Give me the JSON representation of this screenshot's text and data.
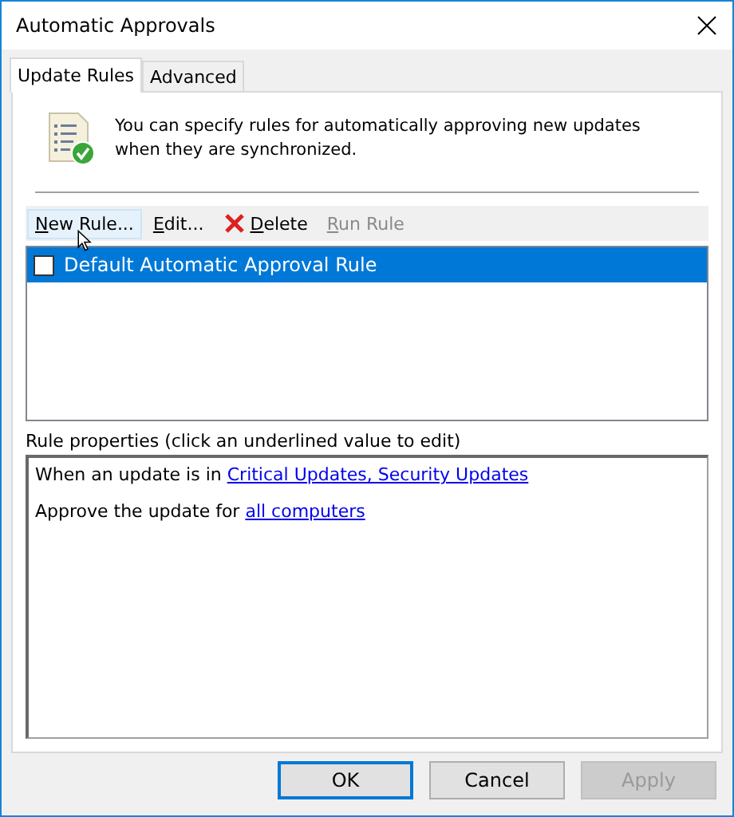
{
  "window": {
    "title": "Automatic Approvals"
  },
  "tabs": [
    {
      "label": "Update Rules",
      "selected": true
    },
    {
      "label": "Advanced",
      "selected": false
    }
  ],
  "intro": "You can specify rules for automatically approving new updates when they are synchronized.",
  "toolbar": [
    {
      "label": "New Rule...",
      "kind": "text",
      "hovered": true,
      "disabled": false
    },
    {
      "label": "Edit...",
      "kind": "text",
      "hovered": false,
      "disabled": false
    },
    {
      "label": "Delete",
      "kind": "delete",
      "hovered": false,
      "disabled": false
    },
    {
      "label": "Run Rule",
      "kind": "text",
      "hovered": false,
      "disabled": true
    }
  ],
  "rules": [
    {
      "name": "Default Automatic Approval Rule",
      "checked": false,
      "selected": true
    }
  ],
  "properties": {
    "label": "Rule properties (click an underlined value to edit)",
    "lines": [
      {
        "text": "When an update is in",
        "link": "Critical Updates, Security Updates"
      },
      {
        "text": "Approve the update for",
        "link": "all computers"
      }
    ]
  },
  "buttons": [
    {
      "label": "OK",
      "default": true,
      "disabled": false
    },
    {
      "label": "Cancel",
      "default": false,
      "disabled": false
    },
    {
      "label": "Apply",
      "default": false,
      "disabled": true
    }
  ]
}
